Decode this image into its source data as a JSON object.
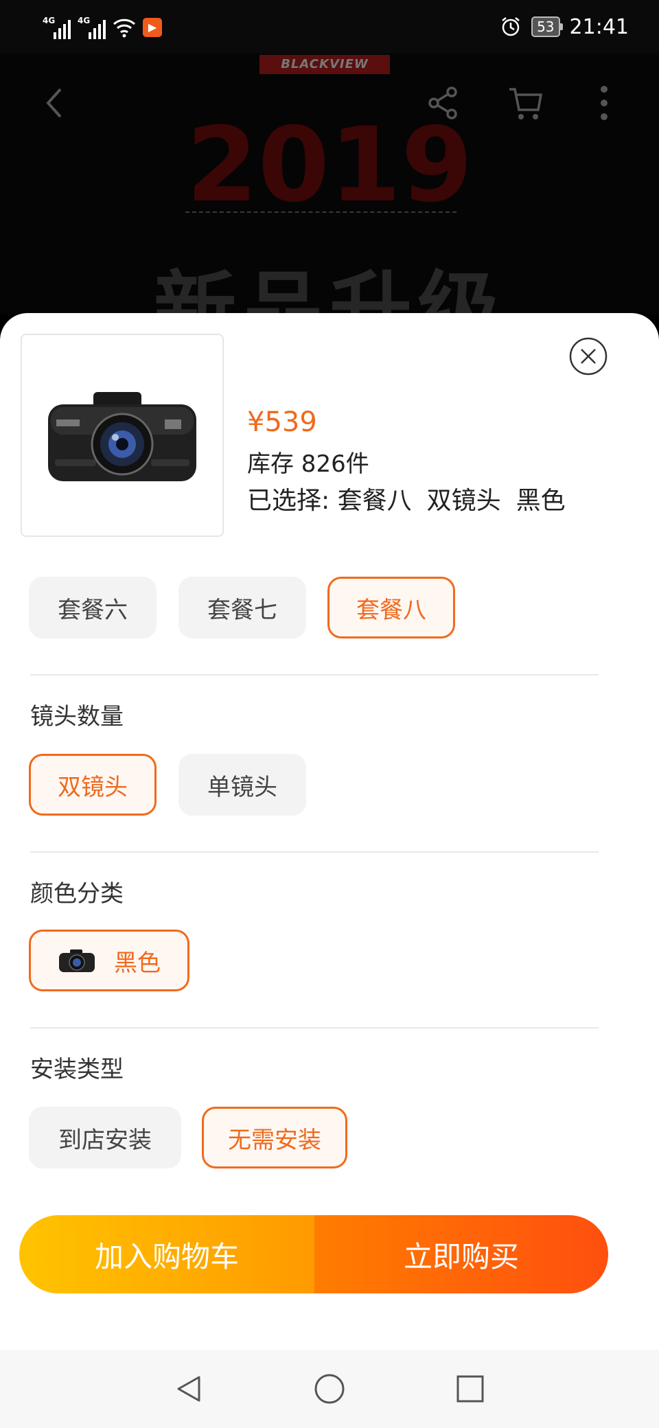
{
  "status_bar": {
    "network_1": "4G",
    "network_2": "4G",
    "app_badge": "▶",
    "battery": "53",
    "time": "21:41"
  },
  "background_page": {
    "brand": "BLACKVIEW",
    "year": "2019",
    "headline": "新品升级"
  },
  "sheet": {
    "price": "¥539",
    "stock": "库存 826件",
    "selected_prefix": "已选择: ",
    "selected_values": [
      "套餐八",
      "双镜头",
      "黑色"
    ]
  },
  "sections": {
    "package": {
      "options": [
        "套餐六",
        "套餐七",
        "套餐八"
      ],
      "selected": "套餐八"
    },
    "lens": {
      "title": "镜头数量",
      "options": [
        "双镜头",
        "单镜头"
      ],
      "selected": "双镜头"
    },
    "color": {
      "title": "颜色分类",
      "options": [
        "黑色"
      ],
      "selected": "黑色"
    },
    "install": {
      "title": "安装类型",
      "options": [
        "到店安装",
        "无需安装"
      ],
      "selected": "无需安装"
    }
  },
  "actions": {
    "add_to_cart": "加入购物车",
    "buy_now": "立即购买"
  },
  "icons": {
    "back": "back-icon",
    "share": "share-icon",
    "cart": "cart-icon",
    "more": "more-icon",
    "close": "close-icon",
    "nav_back": "triangle-back-icon",
    "nav_home": "circle-home-icon",
    "nav_recent": "square-recent-icon"
  },
  "colors": {
    "accent": "#ef6a1d",
    "cart_gradient": [
      "#ffc300",
      "#ff9a00"
    ],
    "buy_gradient": [
      "#ff7d00",
      "#ff4f0f"
    ]
  }
}
